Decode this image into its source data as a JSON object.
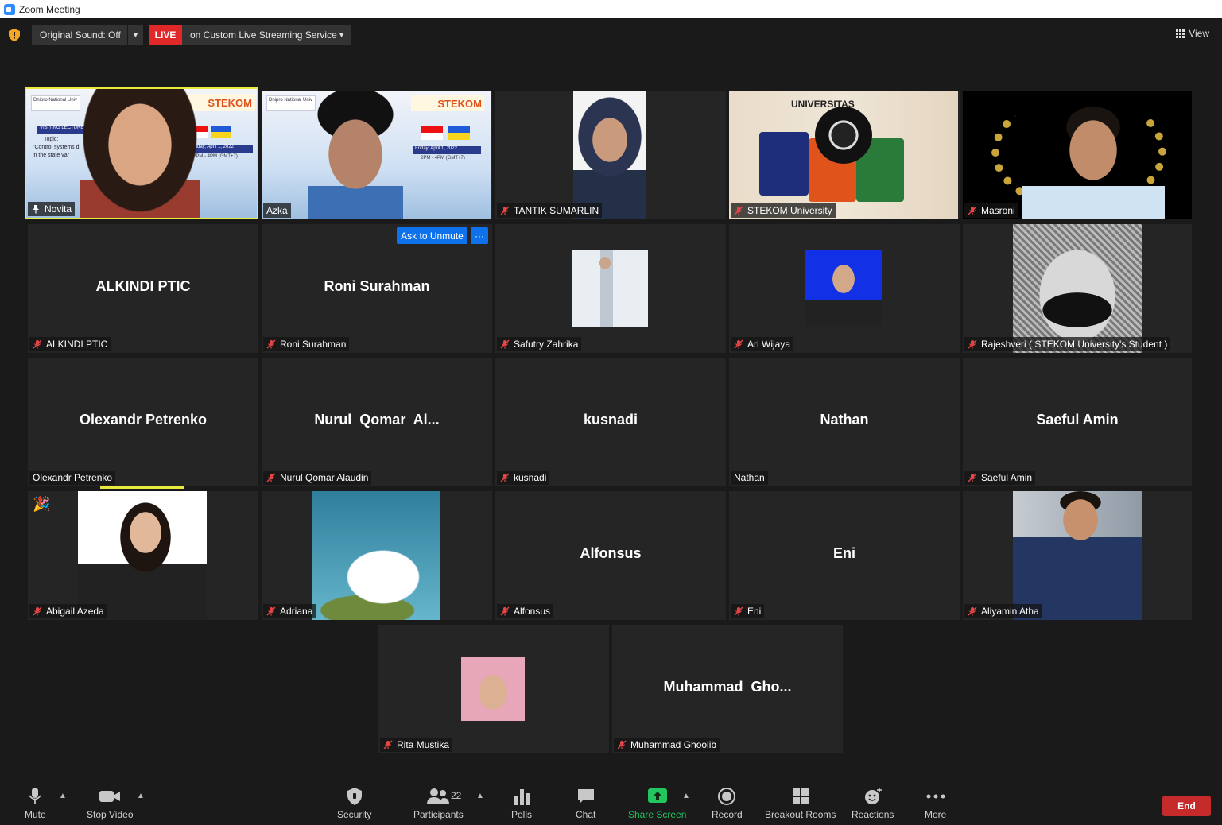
{
  "window": {
    "title": "Zoom Meeting"
  },
  "topbar": {
    "original_sound": "Original Sound: Off",
    "live_badge": "LIVE",
    "live_service": "on Custom Live Streaming Service",
    "view_label": "View"
  },
  "slide": {
    "brand": "STEKOM",
    "date": "Friday, April 1, 2022",
    "time": "2PM - 4PM (GMT+7)",
    "banner": "VISITING LECTURE",
    "topic": "Topic:",
    "topic_line": "\"Control systems d",
    "topic_line2": "in the state var",
    "uni": "Dnipro National Univ"
  },
  "participants": {
    "p01": {
      "name": "Novita"
    },
    "p02": {
      "name": "Azka"
    },
    "p03": {
      "name": "TANTIK SUMARLIN"
    },
    "p04": {
      "name": "STEKOM University",
      "banner": "UNIVERSITAS"
    },
    "p05": {
      "name": "Masroni"
    },
    "p06": {
      "name": "ALKINDI PTIC",
      "big": "ALKINDI PTIC"
    },
    "p07": {
      "name": "Roni Surahman",
      "big": "Roni Surahman"
    },
    "p08": {
      "name": "Safutry Zahrika"
    },
    "p09": {
      "name": "Ari Wijaya"
    },
    "p10": {
      "name": "Rajeshveri ( STEKOM University's Student )"
    },
    "p11": {
      "name": "Olexandr Petrenko",
      "big": "Olexandr Petrenko"
    },
    "p12": {
      "name": "Nurul Qomar Alaudin",
      "big": "Nurul  Qomar  Al..."
    },
    "p13": {
      "name": "kusnadi",
      "big": "kusnadi"
    },
    "p14": {
      "name": "Nathan",
      "big": "Nathan"
    },
    "p15": {
      "name": "Saeful Amin",
      "big": "Saeful Amin"
    },
    "p16": {
      "name": "Abigail Azeda"
    },
    "p17": {
      "name": "Adriana"
    },
    "p18": {
      "name": "Alfonsus",
      "big": "Alfonsus"
    },
    "p19": {
      "name": "Eni",
      "big": "Eni"
    },
    "p20": {
      "name": "Aliyamin Atha"
    },
    "p21": {
      "name": "Rita Mustika"
    },
    "p22": {
      "name": "Muhammad Ghoolib",
      "big": "Muhammad  Gho..."
    }
  },
  "tile_actions": {
    "ask_to_unmute": "Ask to Unmute",
    "more": "···"
  },
  "toolbar": {
    "mute": "Mute",
    "stop_video": "Stop Video",
    "security": "Security",
    "participants": "Participants",
    "participant_count": "22",
    "polls": "Polls",
    "chat": "Chat",
    "share_screen": "Share Screen",
    "record": "Record",
    "breakout_rooms": "Breakout Rooms",
    "reactions": "Reactions",
    "more": "More",
    "end": "End"
  },
  "colors": {
    "accent": "#0e72ed",
    "live": "#e02828",
    "speaking": "#e8ea3d",
    "share": "#22c55e",
    "end": "#c52b2b",
    "tile": "#252525"
  },
  "icons": [
    "shield-icon",
    "mic-off-icon",
    "pin-icon",
    "camera-icon",
    "participants-icon",
    "polls-icon",
    "chat-icon",
    "share-icon",
    "record-icon",
    "breakout-icon",
    "reactions-icon",
    "more-icon",
    "party-icon"
  ]
}
